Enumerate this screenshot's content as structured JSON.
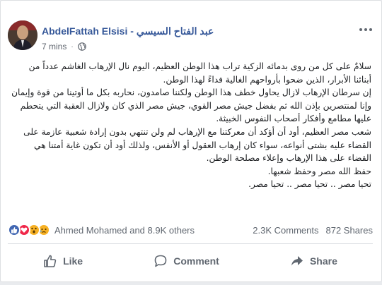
{
  "post": {
    "author": "AbdelFattah Elsisi - عبد الفتاح السيسي",
    "time": "7 mins",
    "separator": "·",
    "paragraphs": [
      "سلامٌ على كل من روى بدمائه الزكية تراب هذا الوطن العظيم، اليوم نال الإرهاب الغاشم عدداً من أبنائنا الأبرار، الذين ضحوا بأرواحهم الغالية فداءً لهذا الوطن.",
      "إن سرطان الإرهاب لازال يحاول خطف هذا الوطن ولكننا صامدون، نحاربه بكل ما أوتينا من قوة وإيمان وإنا لمنتصرين بإذن الله ثم بفضل جيش مصر القوي، جيش مصر الذي كان ولازال العقبة التي يتحطم عليها مطامع وأفكار أصحاب النفوس الخبيثة.",
      "شعب مصر العظيم، أود أن أؤكد أن معركتنا مع الإرهاب لم ولن تنتهي بدون إرادة شعبية عازمة على القضاء عليه بشتى أنواعه، سواء كان إرهاب العقول أو الأنفس، ولذلك أود أن تكون غاية أمتنا هي القضاء على هذا الإرهاب وإعلاء مصلحة الوطن.",
      "حفظ الله مصر وحفظ شعبها.",
      "تحيا مصر .. تحيا مصر .. تحيا مصر."
    ]
  },
  "stats": {
    "reaction_names": "Ahmed Mohamed and 8.9K others",
    "comments": "2.3K Comments",
    "shares": "872 Shares"
  },
  "actions": {
    "like": "Like",
    "comment": "Comment",
    "share": "Share"
  },
  "icons": {
    "globe": "globe-icon",
    "menu": "more-options-icon",
    "like": "thumbs-up-icon",
    "comment": "speech-bubble-icon",
    "share": "share-arrow-icon"
  },
  "colors": {
    "author_link": "#365899",
    "like_reaction": "#4267b2",
    "love_reaction": "#f0284a",
    "wow_reaction": "#f7b125"
  }
}
